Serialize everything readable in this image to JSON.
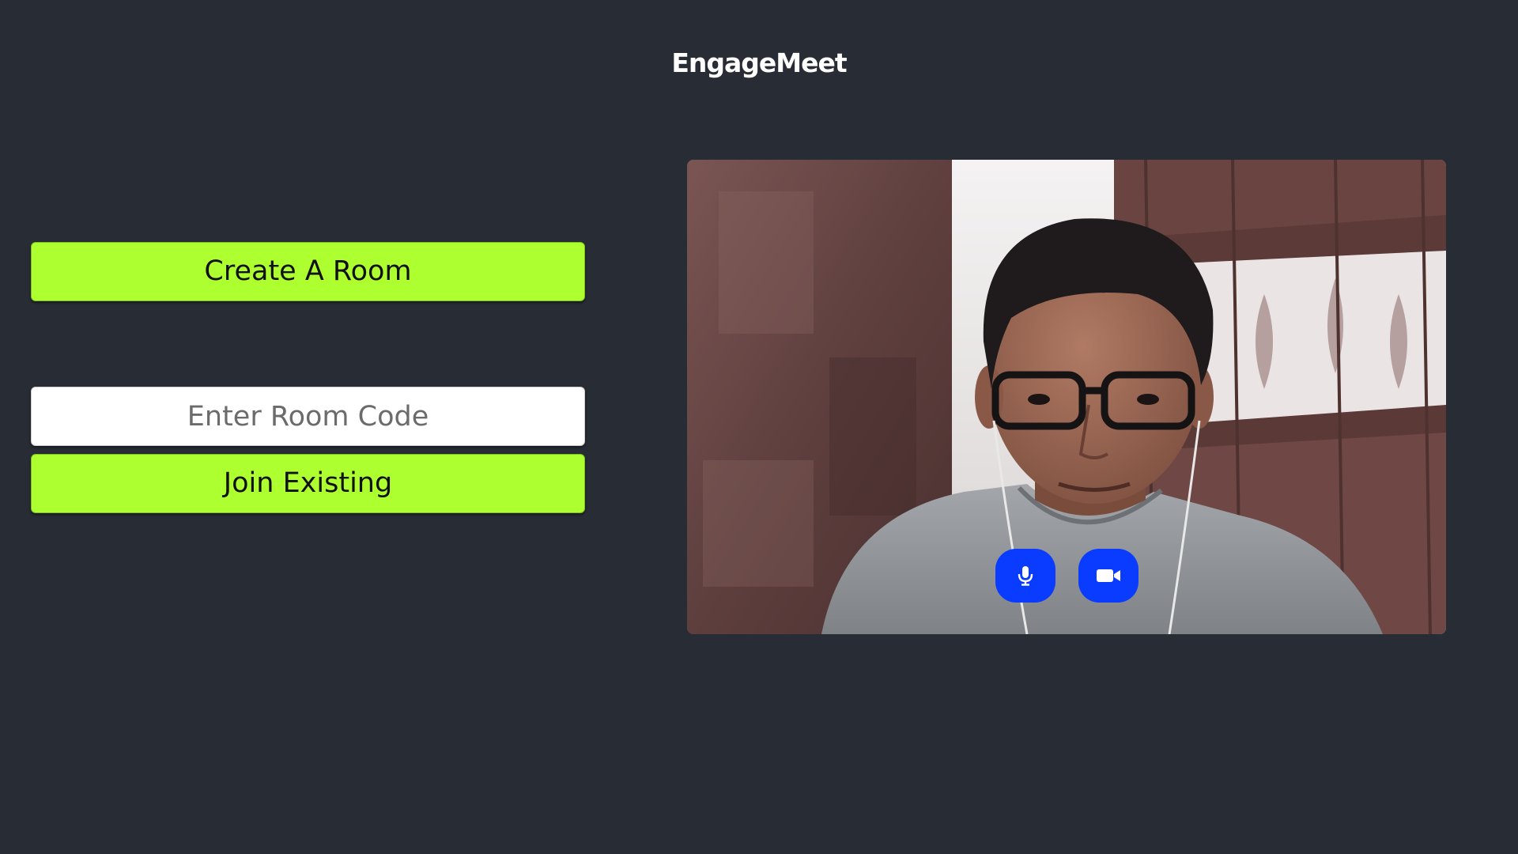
{
  "app": {
    "title": "EngageMeet"
  },
  "lobby": {
    "create_button": "Create A Room",
    "room_code_placeholder": "Enter Room Code",
    "room_code_value": "",
    "join_button": "Join Existing"
  },
  "video_preview": {
    "mic_icon": "microphone-icon",
    "camera_icon": "video-camera-icon"
  },
  "colors": {
    "background": "#282c34",
    "accent_green": "#adff2f",
    "control_blue": "#0a3cff",
    "text_light": "#ffffff"
  }
}
